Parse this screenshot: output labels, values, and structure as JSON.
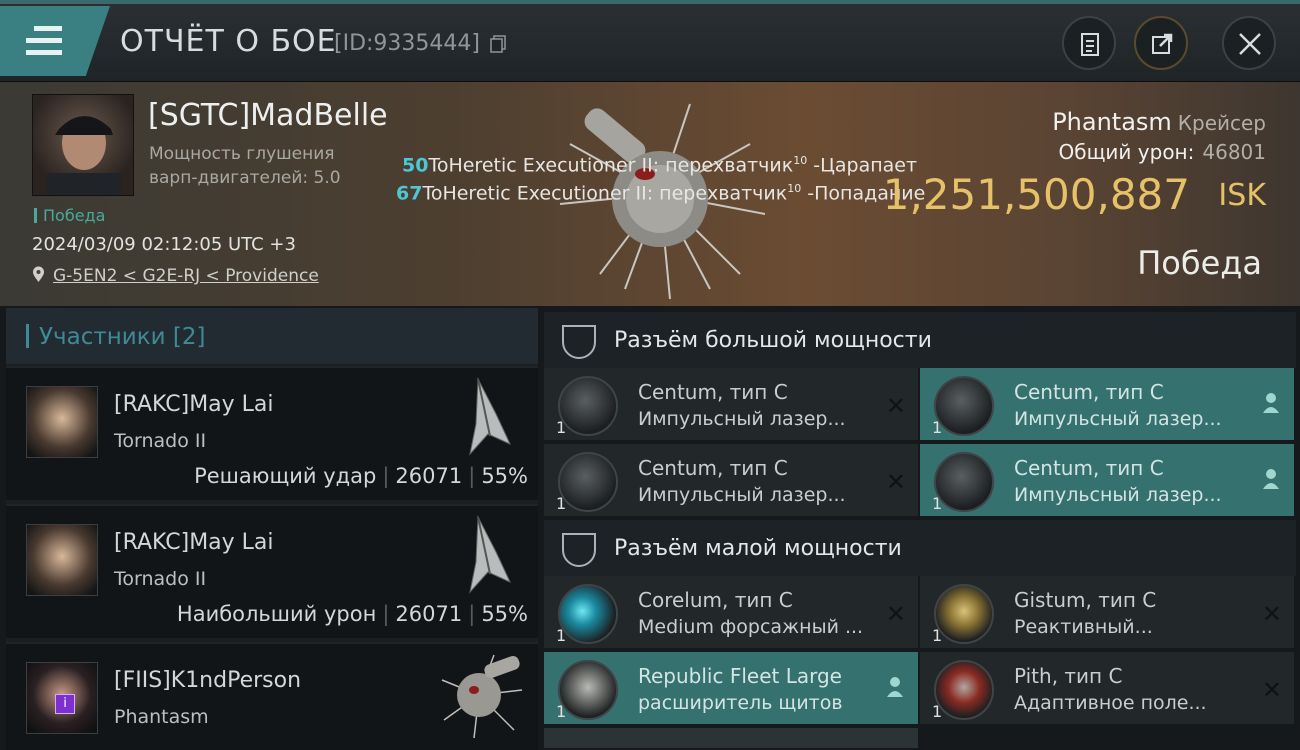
{
  "header": {
    "title": "ОТЧЁТ О БОЕ",
    "report_id": "[ID:9335444]",
    "icons": [
      "menu-icon",
      "copy-icon",
      "clipboard-icon",
      "share-icon",
      "close-icon"
    ]
  },
  "victim": {
    "name": "[SGTC]MadBelle",
    "stat_line1": "Мощность глушения",
    "stat_line2": "варп-двигателей: 5.0",
    "result": "Победа",
    "timestamp": "2024/03/09 02:12:05 UTC +3",
    "location": "G-5EN2 < G2E-RJ < Providence",
    "ship": "Phantasm",
    "ship_class": "Крейсер",
    "total_damage_label": "Общий урон:",
    "total_damage": "46801",
    "isk_value": "1,251,500,887",
    "isk_unit": "ISK",
    "outcome": "Победа"
  },
  "hits": [
    {
      "count": "50",
      "text": "ToHeretic Executioner II: перехватчик",
      "sup": "10",
      "tail": " -Царапает"
    },
    {
      "count": "67",
      "text": "ToHeretic Executioner II: перехватчик",
      "sup": "10",
      "tail": " -Попадание"
    }
  ],
  "participants": {
    "header": "Участники [2]",
    "items": [
      {
        "name": "[RAKC]May Lai",
        "ship": "Tornado II",
        "role": "Решающий удар",
        "damage": "26071",
        "percent": "55%"
      },
      {
        "name": "[RAKC]May Lai",
        "ship": "Tornado II",
        "role": "Наибольший урон",
        "damage": "26071",
        "percent": "55%"
      },
      {
        "name": "[FIIS]K1ndPerson",
        "ship": "Phantasm"
      }
    ]
  },
  "fittings": {
    "high_title": "Разъём большой мощности",
    "low_title": "Разъём малой мощности",
    "high": [
      {
        "name": "Centum, тип C",
        "desc": "Импульсный лазер...",
        "qty": "1",
        "state": "destroyed"
      },
      {
        "name": "Centum, тип C",
        "desc": "Импульсный лазер...",
        "qty": "1",
        "state": "dropped"
      },
      {
        "name": "Centum, тип C",
        "desc": "Импульсный лазер...",
        "qty": "1",
        "state": "destroyed"
      },
      {
        "name": "Centum, тип C",
        "desc": "Импульсный лазер...",
        "qty": "1",
        "state": "dropped"
      }
    ],
    "low": [
      {
        "name": "Corelum, тип C",
        "desc": "Medium форсажный ...",
        "qty": "1",
        "state": "destroyed"
      },
      {
        "name": "Gistum, тип C",
        "desc": "Реактивный...",
        "qty": "1",
        "state": "destroyed"
      },
      {
        "name": "Republic Fleet Large",
        "desc": "расширитель щитов",
        "qty": "1",
        "state": "dropped"
      },
      {
        "name": "Pith, тип C",
        "desc": "Адаптивное поле...",
        "qty": "1",
        "state": "destroyed"
      }
    ],
    "destroyed_mark": "✕"
  },
  "colors": {
    "accent": "#3a7f82",
    "isk": "#e6c168",
    "dropped": "#35716f",
    "hit_count": "#4cc7d4"
  }
}
